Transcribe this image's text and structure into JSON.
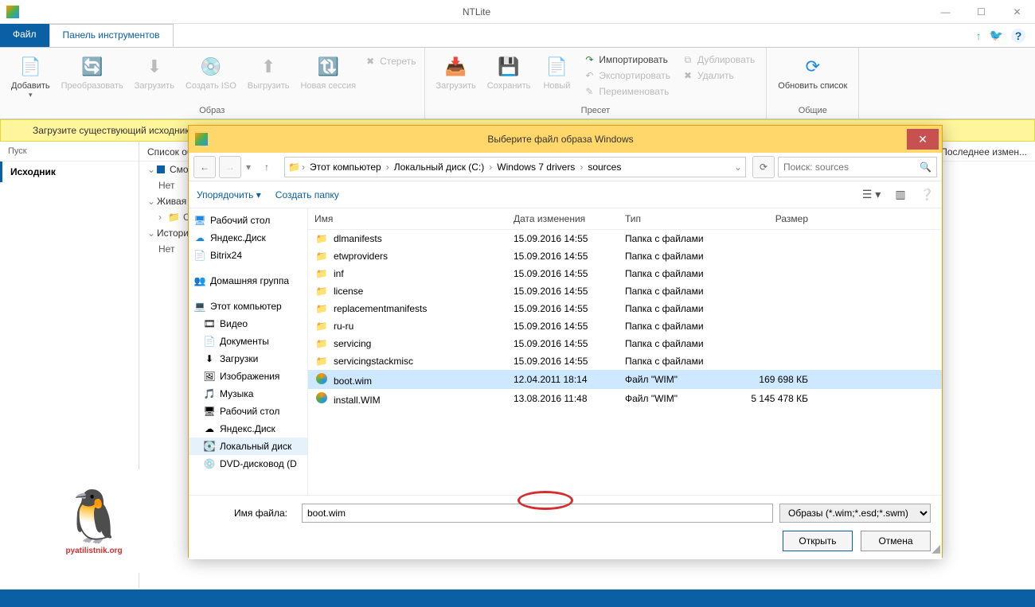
{
  "app": {
    "title": "NTLite"
  },
  "menubar": {
    "file": "Файл",
    "toolbar": "Панель инструментов"
  },
  "ribbon": {
    "group1": {
      "label": "Образ",
      "add": "Добавить",
      "convert": "Преобразовать",
      "load": "Загрузить",
      "createISO": "Создать ISO",
      "unload": "Выгрузить",
      "newSession": "Новая сессия",
      "erase": "Стереть"
    },
    "group2": {
      "label": "Пресет",
      "load": "Загрузить",
      "save": "Сохранить",
      "new": "Новый",
      "import": "Импортировать",
      "export": "Экспортировать",
      "rename": "Переименовать",
      "duplicate": "Дублировать",
      "delete": "Удалить"
    },
    "group3": {
      "label": "Общие",
      "refresh": "Обновить список"
    }
  },
  "infoBar": "Загрузите существующий исходник образа Windows, подключенную систему или образ, который вы хотите редактировать или готовить для записи.",
  "sidePanel": {
    "header": "Пуск",
    "source": "Исходник"
  },
  "tree": {
    "col1": "Список образов",
    "col2": "Последнее измен...",
    "mounted": "Смонтированный",
    "none": "Нет",
    "live": "Живая установка",
    "c": "C:",
    "history": "История",
    "none2": "Нет"
  },
  "dialog": {
    "title": "Выберите файл образа Windows",
    "breadcrumb": [
      "Этот компьютер",
      "Локальный диск (C:)",
      "Windows 7 drivers",
      "sources"
    ],
    "searchPlaceholder": "Поиск: sources",
    "organize": "Упорядочить",
    "newFolder": "Создать папку",
    "navTree": {
      "desktop": "Рабочий стол",
      "yandex": "Яндекс.Диск",
      "bitrix": "Bitrix24",
      "homegroup": "Домашняя группа",
      "thisPC": "Этот компьютер",
      "videos": "Видео",
      "documents": "Документы",
      "downloads": "Загрузки",
      "pictures": "Изображения",
      "music": "Музыка",
      "desktop2": "Рабочий стол",
      "yandex2": "Яндекс.Диск",
      "localDisk": "Локальный диск",
      "dvd": "DVD-дисковод (D"
    },
    "columns": {
      "name": "Имя",
      "date": "Дата изменения",
      "type": "Тип",
      "size": "Размер"
    },
    "files": [
      {
        "name": "dlmanifests",
        "date": "15.09.2016 14:55",
        "type": "Папка с файлами",
        "size": "",
        "kind": "folder"
      },
      {
        "name": "etwproviders",
        "date": "15.09.2016 14:55",
        "type": "Папка с файлами",
        "size": "",
        "kind": "folder"
      },
      {
        "name": "inf",
        "date": "15.09.2016 14:55",
        "type": "Папка с файлами",
        "size": "",
        "kind": "folder"
      },
      {
        "name": "license",
        "date": "15.09.2016 14:55",
        "type": "Папка с файлами",
        "size": "",
        "kind": "folder"
      },
      {
        "name": "replacementmanifests",
        "date": "15.09.2016 14:55",
        "type": "Папка с файлами",
        "size": "",
        "kind": "folder"
      },
      {
        "name": "ru-ru",
        "date": "15.09.2016 14:55",
        "type": "Папка с файлами",
        "size": "",
        "kind": "folder"
      },
      {
        "name": "servicing",
        "date": "15.09.2016 14:55",
        "type": "Папка с файлами",
        "size": "",
        "kind": "folder"
      },
      {
        "name": "servicingstackmisc",
        "date": "15.09.2016 14:55",
        "type": "Папка с файлами",
        "size": "",
        "kind": "folder"
      },
      {
        "name": "boot.wim",
        "date": "12.04.2011 18:14",
        "type": "Файл \"WIM\"",
        "size": "169 698 КБ",
        "kind": "wim",
        "selected": true
      },
      {
        "name": "install.WIM",
        "date": "13.08.2016 11:48",
        "type": "Файл \"WIM\"",
        "size": "5 145 478 КБ",
        "kind": "wim"
      }
    ],
    "fileNameLabel": "Имя файла:",
    "fileName": "boot.wim",
    "filter": "Образы (*.wim;*.esd;*.swm)",
    "open": "Открыть",
    "cancel": "Отмена"
  },
  "logoText": "pyatilistnik.org"
}
